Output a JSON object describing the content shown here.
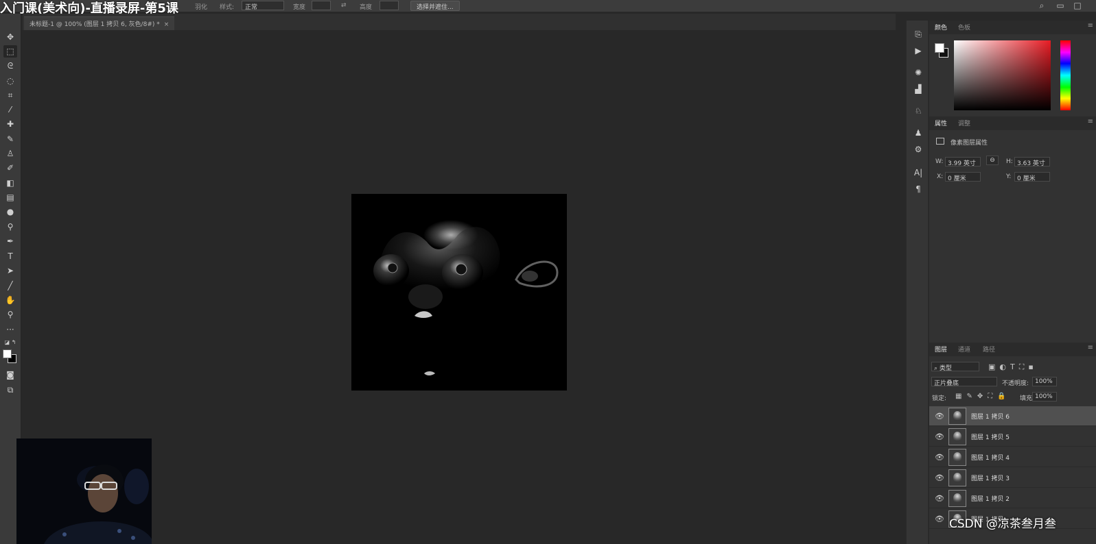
{
  "window": {
    "title_overlay": "入门课(美术向)-直播录屏-第5课"
  },
  "options_bar": {
    "feather_label": "羽化",
    "style_label": "样式:",
    "style_value": "正常",
    "width_label": "宽度",
    "height_label": "高度",
    "select_mask_button": "选择并遮住..."
  },
  "document_tab": {
    "label": "未标题-1 @ 100% (图层 1 拷贝 6, 灰色/8#) *",
    "close": "×"
  },
  "tools": [
    "move-tool",
    "rectangular-marquee-tool",
    "lasso-tool",
    "quick-selection-tool",
    "crop-tool",
    "eyedropper-tool",
    "healing-brush-tool",
    "brush-tool",
    "clone-stamp-tool",
    "history-brush-tool",
    "eraser-tool",
    "gradient-tool",
    "blur-tool",
    "dodge-tool",
    "pen-tool",
    "type-tool",
    "path-selection-tool",
    "line-tool",
    "hand-tool",
    "zoom-tool",
    "more-tools"
  ],
  "color_panel": {
    "tabs": [
      "颜色",
      "色板"
    ],
    "foreground": "#ffffff",
    "background": "#111111",
    "picker_hue": "#e81c24"
  },
  "properties_panel": {
    "tabs": [
      "属性",
      "调整"
    ],
    "section_title": "像素图层属性",
    "w_label": "W:",
    "w_value": "3.99 英寸",
    "h_label": "H:",
    "h_value": "3.63 英寸",
    "x_label": "X:",
    "x_value": "0 厘米",
    "y_label": "Y:",
    "y_value": "0 厘米"
  },
  "layers_panel": {
    "tabs": [
      "图层",
      "通道",
      "路径"
    ],
    "filter_kind": "类型",
    "blend_mode": "正片叠底",
    "opacity_label": "不透明度:",
    "opacity_value": "100%",
    "lock_label": "锁定:",
    "fill_label": "填充:",
    "fill_value": "100%",
    "layers": [
      {
        "name": "图层 1 拷贝 6",
        "selected": true
      },
      {
        "name": "图层 1 拷贝 5",
        "selected": false
      },
      {
        "name": "图层 1 拷贝 4",
        "selected": false
      },
      {
        "name": "图层 1 拷贝 3",
        "selected": false
      },
      {
        "name": "图层 1 拷贝 2",
        "selected": false
      },
      {
        "name": "图层 1 拷贝",
        "selected": false
      }
    ]
  },
  "watermark": "CSDN @凉茶叁月叁"
}
